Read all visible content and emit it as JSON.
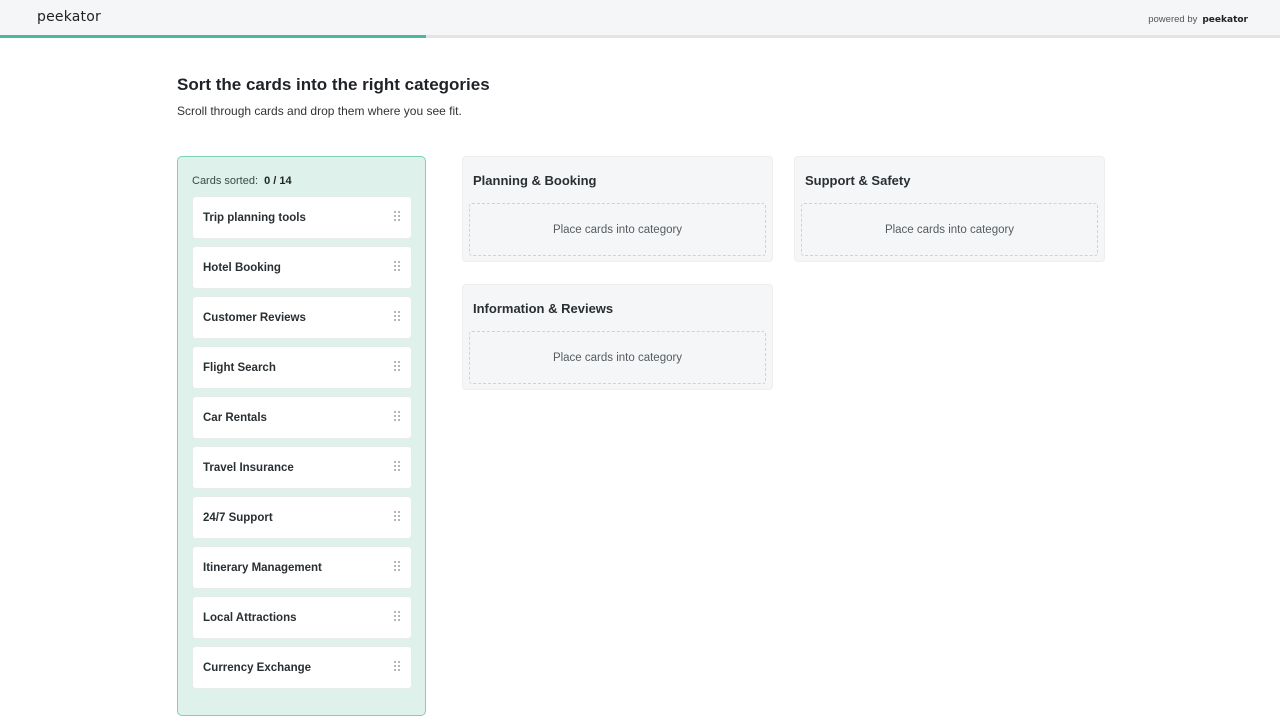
{
  "header": {
    "logo": "peekator",
    "powered_by": "powered by",
    "powered_brand": "peekator",
    "progress_fraction": 0.333
  },
  "task": {
    "title": "Sort the cards into the right categories",
    "subtitle": "Scroll through cards and drop them where you see fit."
  },
  "cards_panel": {
    "sorted_label": "Cards sorted:",
    "sorted_count": "0 / 14",
    "cards": [
      {
        "label": "Trip planning tools"
      },
      {
        "label": "Hotel Booking"
      },
      {
        "label": "Customer Reviews"
      },
      {
        "label": "Flight Search"
      },
      {
        "label": "Car Rentals"
      },
      {
        "label": "Travel Insurance"
      },
      {
        "label": "24/7 Support"
      },
      {
        "label": "Itinerary Management"
      },
      {
        "label": "Local Attractions"
      },
      {
        "label": "Currency Exchange"
      }
    ]
  },
  "categories": [
    {
      "title": "Planning & Booking",
      "placeholder": "Place cards into category"
    },
    {
      "title": "Support & Safety",
      "placeholder": "Place cards into category"
    },
    {
      "title": "Information & Reviews",
      "placeholder": "Place cards into category"
    }
  ],
  "colors": {
    "accent": "#4cb89a",
    "panel_bg": "#def1ea",
    "panel_border": "#7fd1b6"
  }
}
